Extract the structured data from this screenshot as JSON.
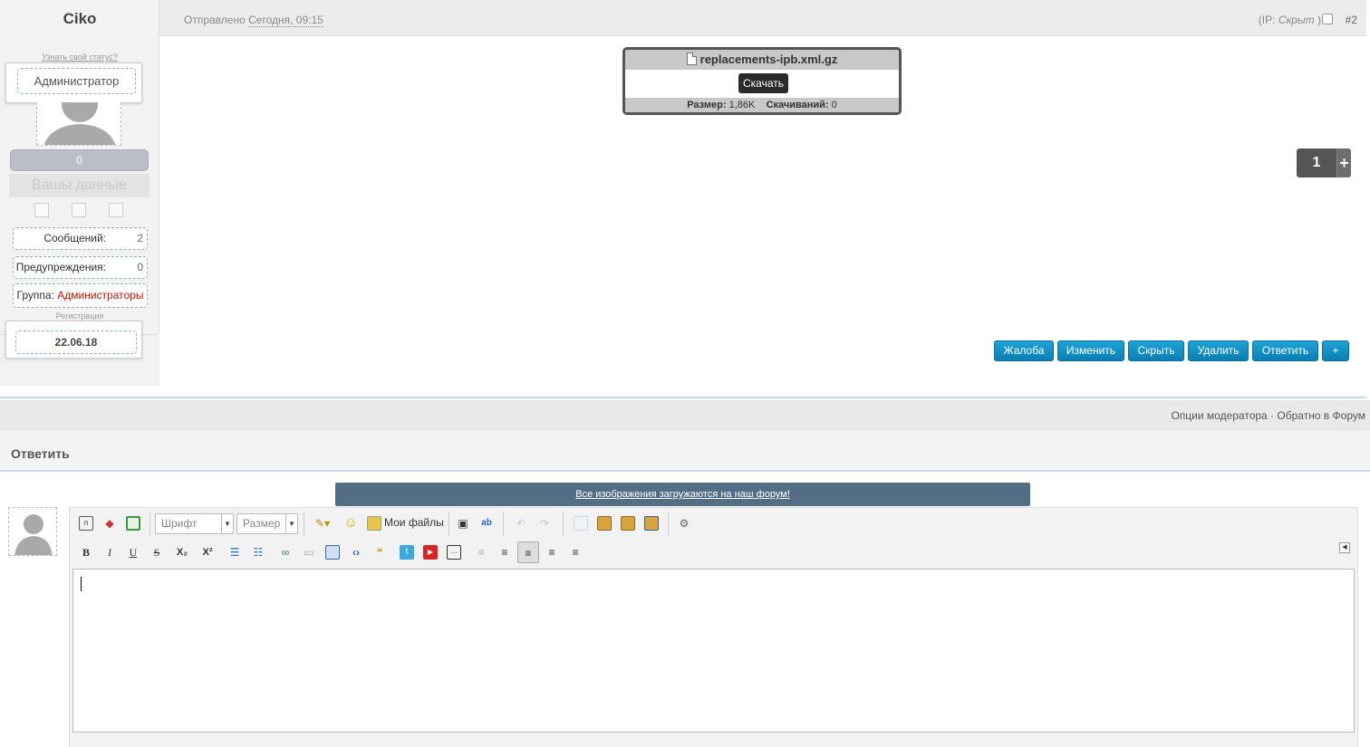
{
  "post": {
    "username": "Ciko",
    "posted_label": "Отправлено",
    "posted_date": "Сегодня, 09:15",
    "ip_label": "(IP:",
    "ip_value": "Скрыт",
    "ip_close": ")",
    "post_number": "#2"
  },
  "author": {
    "status_link": "Узнать свой статус?",
    "role": "Администратор",
    "reputation": "0",
    "your_data": "Вашы данные",
    "stats": [
      {
        "label": "Сообщений:",
        "value": "2"
      },
      {
        "label": "Предупреждения:",
        "value": "0"
      }
    ],
    "group_label": "Группа:",
    "group_value": "Администраторы",
    "reg_label": "Регистрация",
    "reg_date": "22.06.18"
  },
  "attachment": {
    "filename": "replacements-ipb.xml.gz",
    "download_label": "Скачать",
    "size_label": "Размер:",
    "size_value": "1,86K",
    "downloads_label": "Скачиваний:",
    "downloads_value": "0"
  },
  "rating": {
    "value": "1",
    "plus": "+"
  },
  "actions": {
    "report": "Жалоба",
    "edit": "Изменить",
    "hide": "Скрыть",
    "delete": "Удалить",
    "reply": "Ответить",
    "more": "+"
  },
  "moderator": {
    "options": "Опции модератора",
    "separator": "·",
    "back": "Обратно в Форум"
  },
  "reply": {
    "title": "Ответить",
    "notice": "Все изображения загружаются на наш форум!",
    "font_placeholder": "Шрифт",
    "size_placeholder": "Размер",
    "my_files": "Мои файлы"
  },
  "colors": {
    "button": "#0a8cc4",
    "notice_bg": "#526e87",
    "group_red": "#cc1100"
  }
}
